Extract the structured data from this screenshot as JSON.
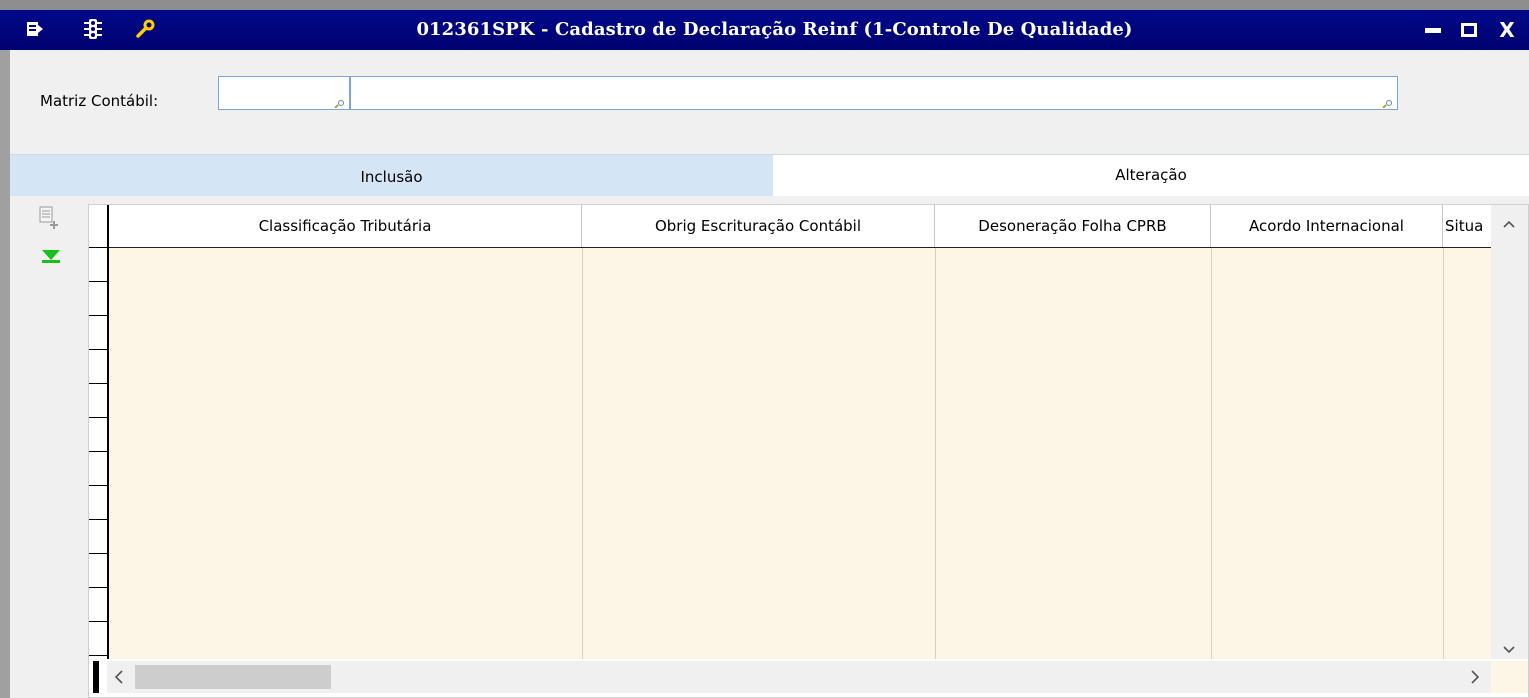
{
  "window": {
    "title": "012361SPK - Cadastro de Declaração Reinf (1-Controle De Qualidade)",
    "controls": {
      "minimize": "▬",
      "maximize": "□",
      "close": "X"
    }
  },
  "form": {
    "matriz_label": "Matriz Contábil:",
    "matriz_code_value": "",
    "matriz_desc_value": ""
  },
  "tabs": [
    {
      "label": "Inclusão",
      "active": false
    },
    {
      "label": "Alteração",
      "active": true
    }
  ],
  "grid": {
    "columns": [
      "Classificação Tributária",
      "Obrig Escrituração Contábil",
      "Desoneração Folha CPRB",
      "Acordo Internacional",
      "Situa"
    ],
    "rows": []
  },
  "colors": {
    "titlebar": "#00007a",
    "grid_body": "#fdf6e6",
    "tab_inactive": "#d4e5f6",
    "accent_green": "#19c019"
  },
  "icons": {
    "titlebar": [
      "menu-icon",
      "traffic-light-icon",
      "wrench-icon"
    ],
    "tools": [
      "add-record-icon",
      "download-arrow-icon"
    ]
  }
}
